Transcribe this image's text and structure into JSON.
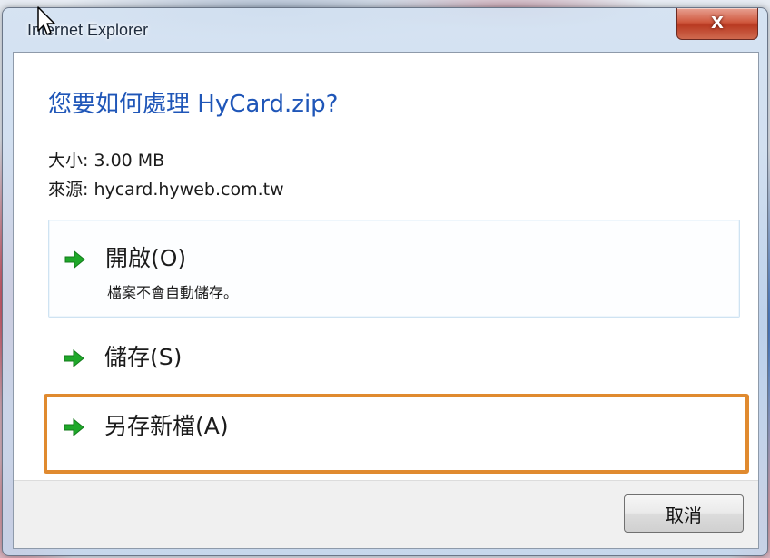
{
  "window": {
    "title": "Internet Explorer",
    "close_label": "X"
  },
  "dialog": {
    "question": "您要如何處理 HyCard.zip?",
    "size_line": "大小: 3.00 MB",
    "source_line": "來源: hycard.hyweb.com.tw"
  },
  "options": [
    {
      "label": "開啟(O)",
      "sublabel": "檔案不會自動儲存。",
      "icon": "green-arrow-icon"
    },
    {
      "label": "儲存(S)",
      "icon": "green-arrow-icon"
    },
    {
      "label": "另存新檔(A)",
      "icon": "green-arrow-icon"
    }
  ],
  "footer": {
    "cancel_label": "取消"
  },
  "colors": {
    "question_blue": "#1f56b8",
    "arrow_green": "#1fa82a",
    "highlight_orange": "#e08a2f",
    "close_red": "#c74a30"
  }
}
